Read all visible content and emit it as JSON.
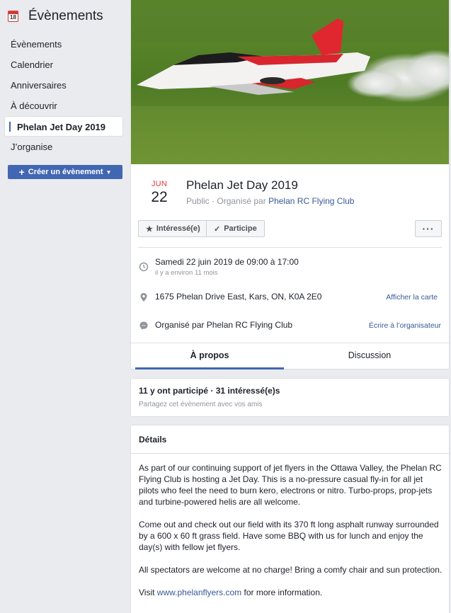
{
  "sidebar": {
    "title": "Évènements",
    "calendar_icon_day": "18",
    "items": [
      {
        "label": "Évènements"
      },
      {
        "label": "Calendrier"
      },
      {
        "label": "Anniversaires"
      },
      {
        "label": "À découvrir"
      },
      {
        "label": "Phelan Jet Day 2019"
      },
      {
        "label": "J’organise"
      }
    ],
    "create_button": "Créer un évènement"
  },
  "event": {
    "month": "JUN",
    "day": "22",
    "title": "Phelan Jet Day 2019",
    "privacy": "Public",
    "organized_by_prefix": "Organisé par",
    "organizer": "Phelan RC Flying Club",
    "buttons": {
      "interested": "Intéressé(e)",
      "going": "Participe",
      "more": "···"
    },
    "datetime": "Samedi 22 juin 2019 de 09:00 à 17:00",
    "relative_time": "il y a environ 11 mois",
    "address": "1675 Phelan Drive East, Kars, ON, K0A 2E0",
    "map_link": "Afficher la carte",
    "organizer_line": "Organisé par Phelan RC Flying Club",
    "contact_link": "Écrire à l’organisateur",
    "tabs": [
      "À propos",
      "Discussion"
    ]
  },
  "stats": {
    "summary": "11 y ont participé · 31 intéressé(e)s",
    "share": "Partagez cet évènement avec vos amis"
  },
  "details": {
    "heading": "Détails",
    "p1": "As part of our continuing support of jet flyers in the Ottawa Valley, the Phelan RC Flying Club is hosting a Jet Day. This is a no-pressure casual fly-in for all jet pilots who feel the need to burn kero, electrons or nitro. Turbo-props, prop-jets and turbine-powered helis are all welcome.",
    "p2": "Come out and check out our field with its 370 ft long asphalt runway surrounded by a 600 x 60 ft grass field. Have some BBQ with us for lunch and enjoy the day(s) with fellow jet flyers.",
    "p3": "All spectators are welcome at no charge!  Bring a comfy chair and sun protection.",
    "p4_prefix": "Visit ",
    "p4_link": "www.phelanflyers.com",
    "p4_suffix": " for more information."
  },
  "colors": {
    "accent": "#4267b2",
    "date_red": "#e0393e",
    "link": "#385898"
  }
}
